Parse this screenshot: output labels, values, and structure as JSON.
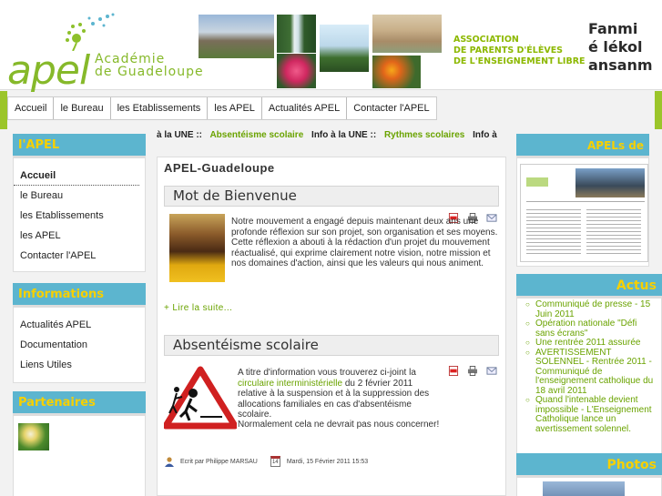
{
  "header": {
    "logo_text": "apel",
    "academie_line1": "Académie",
    "academie_line2": "de Guadeloupe",
    "association_line1": "ASSOCIATION",
    "association_line2": "DE PARENTS D'ÉLÈVES",
    "association_line3": "DE L'ENSEIGNEMENT LIBRE",
    "slogan_line1": "Fanmi",
    "slogan_line2": "é lékol",
    "slogan_line3": "ansanm"
  },
  "nav": {
    "items": [
      "Accueil",
      "le Bureau",
      "les Etablissements",
      "les APEL",
      "Actualités APEL",
      "Contacter l'APEL"
    ]
  },
  "ticker": {
    "items": [
      {
        "text": "à la UNE ::",
        "style": "dark"
      },
      {
        "text": "Absentéisme scolaire",
        "style": "green"
      },
      {
        "text": "Info à la UNE ::",
        "style": "dark"
      },
      {
        "text": "Rythmes scolaires",
        "style": "green"
      },
      {
        "text": "Info à",
        "style": "dark"
      }
    ]
  },
  "left": {
    "apel_title": "l'APEL",
    "apel_items": [
      "Accueil",
      "le Bureau",
      "les Etablissements",
      "les APEL",
      "Contacter l'APEL"
    ],
    "info_title": "Informations",
    "info_items": [
      "Actualités APEL",
      "Documentation",
      "Liens Utiles"
    ],
    "partners_title": "Partenaires"
  },
  "center": {
    "site_title": "APEL-Guadeloupe",
    "article1": {
      "title": "Mot de Bienvenue",
      "body": "Notre mouvement a engagé depuis maintenant deux ans une profonde réflexion sur son projet, son organisation et ses moyens. Cette réflexion a abouti à la rédaction d'un projet du mouvement réactualisé, qui exprime clairement notre vision, notre mission et nos domaines d'action, ainsi que les valeurs qui nous animent.",
      "read_more": "+ Lire la suite..."
    },
    "article2": {
      "title": "Absentéisme scolaire",
      "body_before": "A titre d'information vous trouverez ci-joint la",
      "body_link": "circulaire interministérielle",
      "body_after": "du 2 février 2011 relative à la suspension et à la suppression des allocations familiales en cas d'absentéisme scolaire.",
      "body2": "Normalement cela ne devrait pas nous concerner!",
      "author": "Ecrit par Philippe MARSAU",
      "date": "Mardi, 15 Février 2011 15:53",
      "calendar_day": "14"
    }
  },
  "right": {
    "apels_title": "APELs de Guadeloupe",
    "actus_title": "Actus",
    "actus_items": [
      "Communiqué de presse - 15 Juin 2011",
      "Opération nationale \"Défi sans écrans\"",
      "Une rentrée 2011 assurée",
      "AVERTISSEMENT SOLENNEL - Rentrée 2011 - Communiqué de l'enseignement catholique du 18 avril 2011",
      "Quand l'intenable devient impossible - L'Enseignement Catholique lance un avertissement solennel."
    ],
    "photos_title": "Photos"
  },
  "colors": {
    "accent_green": "#86b92a",
    "box_blue": "#5cb5cf",
    "title_yellow": "#f7d000",
    "link_green": "#6aa300"
  }
}
